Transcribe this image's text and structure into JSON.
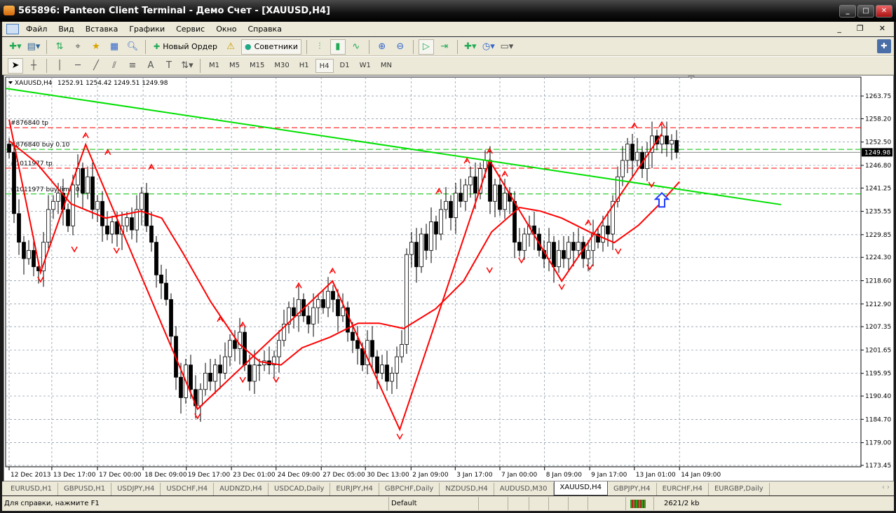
{
  "window": {
    "title": "565896: Panteon Client Terminal - Демо Счет - [XAUUSD,H4]"
  },
  "menu": [
    "Файл",
    "Вид",
    "Вставка",
    "Графики",
    "Сервис",
    "Окно",
    "Справка"
  ],
  "toolbar": {
    "new_order": "Новый Ордер",
    "experts": "Советники"
  },
  "timeframes": [
    "M1",
    "M5",
    "M15",
    "M30",
    "H1",
    "H4",
    "D1",
    "W1",
    "MN"
  ],
  "active_timeframe": "H4",
  "chart_data": {
    "type": "candlestick",
    "symbol_label": "XAUUSD,H4",
    "ohlc_label": "1252.91 1254.42 1249.51 1249.98",
    "current_price": "1249.98",
    "ylim": [
      1173.45,
      1263.75
    ],
    "y_ticks": [
      "1263.75",
      "1258.20",
      "1252.50",
      "1246.80",
      "1241.25",
      "1235.55",
      "1229.85",
      "1224.30",
      "1218.60",
      "1212.90",
      "1207.35",
      "1201.65",
      "1195.95",
      "1190.40",
      "1184.70",
      "1179.00",
      "1173.45"
    ],
    "x_ticks": [
      {
        "bar": 0,
        "label": "12 Dec 2013"
      },
      {
        "bar": 8.7,
        "label": "13 Dec 17:00"
      },
      {
        "bar": 18,
        "label": "17 Dec 00:00"
      },
      {
        "bar": 27.3,
        "label": "18 Dec 09:00"
      },
      {
        "bar": 36.1,
        "label": "19 Dec 17:00"
      },
      {
        "bar": 45.3,
        "label": "23 Dec 01:00"
      },
      {
        "bar": 54.4,
        "label": "24 Dec 09:00"
      },
      {
        "bar": 63.6,
        "label": "27 Dec 05:00"
      },
      {
        "bar": 72.6,
        "label": "30 Dec 13:00"
      },
      {
        "bar": 81.9,
        "label": "2 Jan 09:00"
      },
      {
        "bar": 90.9,
        "label": "3 Jan 17:00"
      },
      {
        "bar": 100,
        "label": "7 Jan 00:00"
      },
      {
        "bar": 109.1,
        "label": "8 Jan 09:00"
      },
      {
        "bar": 118.3,
        "label": "9 Jan 17:00"
      },
      {
        "bar": 127.4,
        "label": "13 Jan 01:00"
      },
      {
        "bar": 136.6,
        "label": "14 Jan 09:00"
      }
    ],
    "closes": [
      1250,
      1235,
      1228,
      1224,
      1226,
      1222,
      1221,
      1228,
      1236,
      1238,
      1240,
      1236,
      1232,
      1242,
      1246,
      1240,
      1244,
      1236,
      1238,
      1232,
      1230,
      1233,
      1230,
      1232,
      1234,
      1231,
      1236,
      1240,
      1232,
      1228,
      1220,
      1218,
      1214,
      1205,
      1195,
      1190,
      1198,
      1192,
      1188,
      1192,
      1196,
      1194,
      1198,
      1196,
      1200,
      1204,
      1202,
      1206,
      1198,
      1194,
      1198,
      1198,
      1199,
      1198,
      1200,
      1204,
      1208,
      1212,
      1210,
      1214,
      1210,
      1208,
      1212,
      1214,
      1212,
      1216,
      1214,
      1210,
      1212,
      1206,
      1204,
      1202,
      1198,
      1204,
      1200,
      1196,
      1198,
      1194,
      1196,
      1200,
      1203,
      1225,
      1228,
      1222,
      1230,
      1226,
      1233,
      1230,
      1236,
      1238,
      1234,
      1240,
      1238,
      1242,
      1244,
      1240,
      1246,
      1248,
      1238,
      1242,
      1236,
      1240,
      1238,
      1228,
      1226,
      1230,
      1232,
      1230,
      1226,
      1224,
      1228,
      1222,
      1226,
      1224,
      1228,
      1226,
      1228,
      1224,
      1226,
      1230,
      1228,
      1232,
      1230,
      1238,
      1244,
      1248,
      1252,
      1248,
      1250,
      1246,
      1250,
      1254,
      1252,
      1254,
      1252,
      1252.91,
      1249.98
    ],
    "zigzag": [
      [
        0,
        1258
      ],
      [
        6.4,
        1220.6
      ],
      [
        15.6,
        1251.9
      ],
      [
        38.4,
        1187.2
      ],
      [
        65.9,
        1218.5
      ],
      [
        79.6,
        1182.2
      ],
      [
        97.9,
        1248
      ],
      [
        112.6,
        1218.5
      ],
      [
        133,
        1254.5
      ]
    ],
    "moving_average": [
      [
        0,
        1252.8
      ],
      [
        5.4,
        1247.6
      ],
      [
        12.6,
        1237.4
      ],
      [
        19.7,
        1233.9
      ],
      [
        26.9,
        1235.6
      ],
      [
        31.1,
        1233.9
      ],
      [
        35.4,
        1225.4
      ],
      [
        41.1,
        1213.4
      ],
      [
        46.9,
        1203.1
      ],
      [
        51.1,
        1198.8
      ],
      [
        55.4,
        1198
      ],
      [
        59.7,
        1202.2
      ],
      [
        65.4,
        1204.8
      ],
      [
        71.1,
        1208.2
      ],
      [
        75.4,
        1208.2
      ],
      [
        80.4,
        1206.9
      ],
      [
        86.9,
        1211.7
      ],
      [
        92.6,
        1218.5
      ],
      [
        98.3,
        1230.5
      ],
      [
        104,
        1236.5
      ],
      [
        108.3,
        1235.6
      ],
      [
        112.6,
        1233.9
      ],
      [
        118.3,
        1230.5
      ],
      [
        123.3,
        1227.9
      ],
      [
        128.3,
        1232.2
      ],
      [
        132.6,
        1237.4
      ],
      [
        136.6,
        1242.8
      ]
    ],
    "trendline": [
      [
        -0.6,
        1265.6
      ],
      [
        157.3,
        1237.2
      ]
    ],
    "fractals_up": [
      [
        15.6,
        1254
      ],
      [
        20.1,
        1249.9
      ],
      [
        29,
        1246.3
      ],
      [
        43,
        1209.1
      ],
      [
        47.6,
        1207.7
      ],
      [
        59,
        1217.3
      ],
      [
        65.9,
        1220.9
      ],
      [
        87.6,
        1240.4
      ],
      [
        93.3,
        1247.8
      ],
      [
        97.9,
        1250.2
      ],
      [
        101,
        1244.6
      ],
      [
        118,
        1232.7
      ],
      [
        127.4,
        1256.4
      ],
      [
        133,
        1256.7
      ]
    ],
    "fractals_down": [
      [
        6.4,
        1219
      ],
      [
        13.3,
        1226.4
      ],
      [
        21.9,
        1226.1
      ],
      [
        38.4,
        1185.6
      ],
      [
        47.6,
        1194.5
      ],
      [
        54.4,
        1194.5
      ],
      [
        79.6,
        1180.6
      ],
      [
        97.9,
        1221.3
      ],
      [
        104.4,
        1223.7
      ],
      [
        112.6,
        1217.2
      ],
      [
        118.3,
        1222
      ],
      [
        124.1,
        1225.9
      ],
      [
        130.9,
        1242.2
      ]
    ],
    "buy_signal": [
      133,
      1238
    ],
    "order_lines": [
      {
        "label": "#876840 tp",
        "price": 1256.0,
        "color": "#ff0000"
      },
      {
        "label": "#876840 buy 0.10",
        "price": 1250.7,
        "color": "#00c000"
      },
      {
        "label": "#1011977 tp",
        "price": 1246.1,
        "color": "#ff0000"
      },
      {
        "label": "#1011977 buy limit 0.20",
        "price": 1239.8,
        "color": "#00c000"
      }
    ],
    "colors": {
      "zigzag": "#ff0000",
      "ma": "#ff0000",
      "trendline": "#00e000",
      "signal": "#1e3cff"
    }
  },
  "tabs": [
    "EURUSD,H1",
    "GBPUSD,H1",
    "USDJPY,H4",
    "USDCHF,H4",
    "AUDNZD,H4",
    "USDCAD,Daily",
    "EURJPY,H4",
    "GBPCHF,Daily",
    "NZDUSD,H4",
    "AUDUSD,M30",
    "XAUUSD,H4",
    "GBPJPY,H4",
    "EURCHF,H4",
    "EURGBP,Daily"
  ],
  "active_tab": "XAUUSD,H4",
  "status": {
    "help": "Для справки, нажмите F1",
    "profile": "Default",
    "traffic": "2621/2 kb"
  }
}
